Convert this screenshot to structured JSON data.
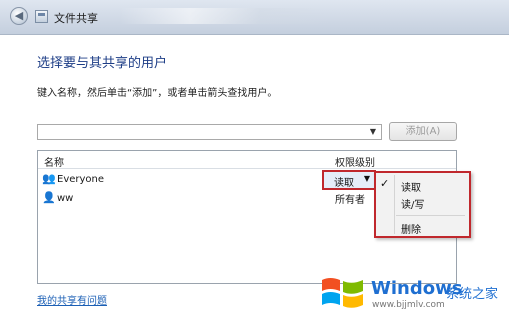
{
  "window": {
    "title": "文件共享"
  },
  "dialog": {
    "heading": "选择要与其共享的用户",
    "instruction": "键入名称，然后单击“添加”，或者单击箭头查找用户。",
    "add_button": "添加(A)"
  },
  "list": {
    "columns": {
      "name": "名称",
      "permission": "权限级别"
    },
    "rows": [
      {
        "name": "Everyone",
        "permission": "读取"
      },
      {
        "name": "ww",
        "permission": "所有者"
      }
    ]
  },
  "context_menu": {
    "items": [
      "读取",
      "读/写",
      "删除"
    ],
    "checked_index": 0,
    "check_mark": "✓"
  },
  "footer": {
    "help_link": "我的共享有问题"
  },
  "watermark": {
    "brand": "Windows",
    "suffix": "系统之家",
    "url": "www.bjjmlv.com"
  },
  "colors": {
    "heading": "#1d3d86",
    "highlight_border": "#c0282d",
    "link": "#1b5fb5",
    "brand_blue": "#1f6fd1"
  }
}
